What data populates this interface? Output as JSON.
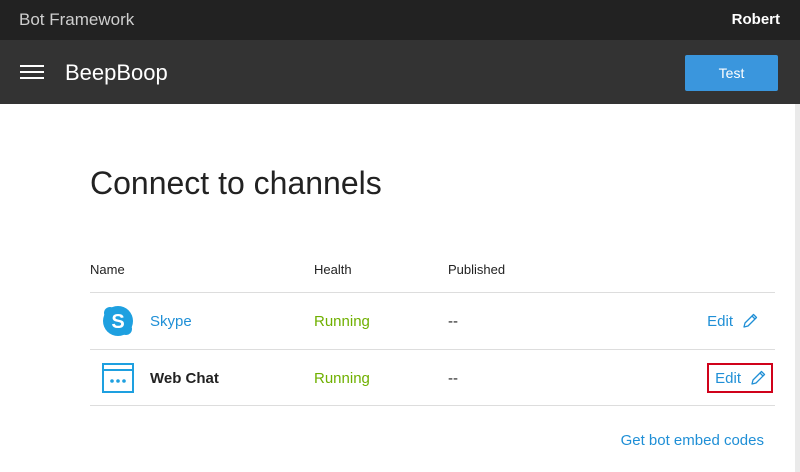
{
  "topbar": {
    "brand": "Bot Framework",
    "user": "Robert"
  },
  "header": {
    "bot_name": "BeepBoop",
    "test_label": "Test"
  },
  "page": {
    "title": "Connect to channels"
  },
  "table": {
    "columns": [
      "Name",
      "Health",
      "Published"
    ],
    "rows": [
      {
        "name": "Skype",
        "health": "Running",
        "published": "--",
        "edit": "Edit",
        "icon": "skype-icon"
      },
      {
        "name": "Web Chat",
        "health": "Running",
        "published": "--",
        "edit": "Edit",
        "icon": "web-chat-icon"
      }
    ]
  },
  "embed_link": "Get bot embed codes",
  "colors": {
    "accent": "#3a96dd",
    "link": "#1f8fd6",
    "status_running": "#6fb000",
    "highlight": "#d0021b"
  }
}
